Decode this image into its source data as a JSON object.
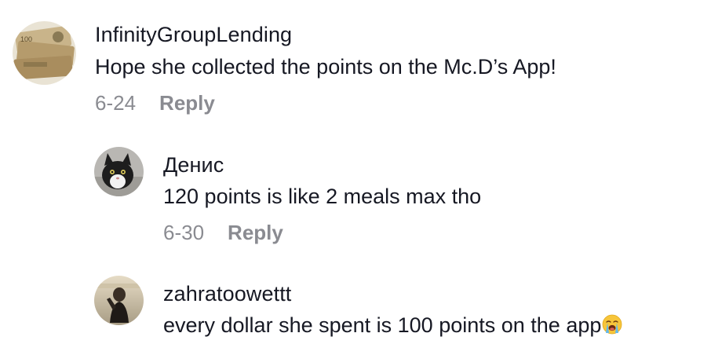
{
  "comments": [
    {
      "username": "InfinityGroupLending",
      "text": "Hope she collected the points on the Mc.D’s App!",
      "date": "6-24",
      "reply_label": "Reply",
      "avatar_icon": "money-stack-avatar"
    },
    {
      "username": "Денис",
      "text": "120 points is like 2 meals max tho",
      "date": "6-30",
      "reply_label": "Reply",
      "avatar_icon": "cat-avatar"
    },
    {
      "username": "zahratoowettt",
      "text": "every dollar she spent is 100 points on the app",
      "emoji": "loudly-crying-face-emoji",
      "avatar_icon": "person-photo-avatar"
    }
  ],
  "colors": {
    "username": "#161823",
    "text": "#161823",
    "meta": "#8a8b91"
  }
}
